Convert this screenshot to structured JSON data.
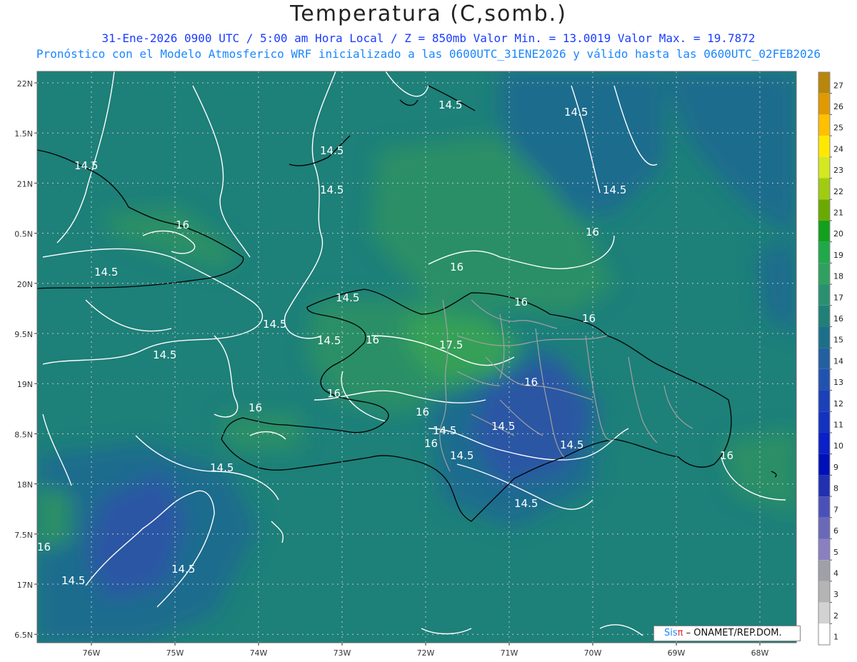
{
  "header": {
    "title": "Temperatura (C,somb.)",
    "line1": "31-Ene-2026  0900 UTC / 5:00 am Hora Local / Z = 850mb    Valor Min. = 13.0019  Valor Max. = 19.7872",
    "line2": "Pronóstico con el Modelo Atmosferico WRF inicializado a las 0600UTC_31ENE2026 y válido hasta las  0600UTC_02FEB2026"
  },
  "map": {
    "lon_ticks": [
      "76W",
      "75W",
      "74W",
      "73W",
      "72W",
      "71W",
      "70W",
      "69W",
      "68W"
    ],
    "lat_ticks": [
      "22N",
      "1.5N",
      "21N",
      "0.5N",
      "20N",
      "9.5N",
      "19N",
      "8.5N",
      "18N",
      "7.5N",
      "17N",
      "6.5N"
    ],
    "contour_labels": [
      "14.5",
      "16",
      "17.5"
    ],
    "colors": {
      "base": "#1d8079",
      "cool": "#1c6c8e",
      "cold": "#2a56a4",
      "warm": "#2b8f66",
      "warmer": "#35a058",
      "land_border": "#000000",
      "province_border": "#a0a0a0",
      "contour": "#ffffff"
    }
  },
  "colorbar": {
    "labels": [
      "27",
      "26",
      "25",
      "24",
      "23",
      "22",
      "21",
      "20",
      "19",
      "18",
      "17",
      "16",
      "15",
      "14",
      "13",
      "12",
      "11",
      "10",
      "9",
      "8",
      "7",
      "6",
      "5",
      "4",
      "3",
      "2",
      "1"
    ],
    "colors": [
      "#b8860b",
      "#e09a00",
      "#ffc000",
      "#ffe800",
      "#d4e820",
      "#a0cc10",
      "#6aaa00",
      "#12a01e",
      "#20a84a",
      "#30a060",
      "#2a9070",
      "#208078",
      "#1c6f88",
      "#2260a0",
      "#2252b0",
      "#1c40b8",
      "#1432c0",
      "#0a20c8",
      "#0010b8",
      "#2030b0",
      "#4a50b8",
      "#6a68b8",
      "#8a80c0",
      "#a0a0a8",
      "#b4b4b4",
      "#d2d2d2",
      "#ffffff"
    ]
  },
  "credit": {
    "brand": "Sis",
    "pi": "π",
    "text": "– ONAMET/REP.DOM."
  }
}
